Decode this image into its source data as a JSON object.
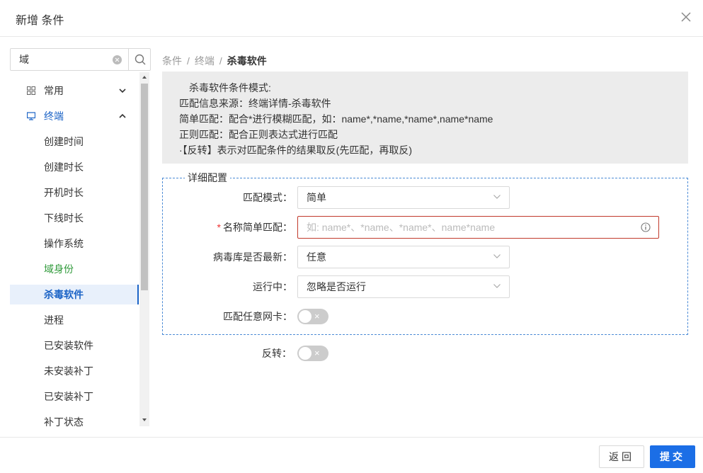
{
  "dialog": {
    "title": "新增 条件"
  },
  "search": {
    "value": "域",
    "placeholder": ""
  },
  "tree": {
    "groups": [
      {
        "label": "常用",
        "icon": "grid-icon",
        "expanded": false
      },
      {
        "label": "终端",
        "icon": "monitor-icon",
        "expanded": true
      }
    ],
    "children": [
      "创建时间",
      "创建时长",
      "开机时长",
      "下线时长",
      "操作系统",
      "域身份",
      "杀毒软件",
      "进程",
      "已安装软件",
      "未安装补丁",
      "已安装补丁",
      "补丁状态"
    ]
  },
  "breadcrumb": {
    "items": [
      "条件",
      "终端"
    ],
    "current": "杀毒软件"
  },
  "info": {
    "lines": [
      "杀毒软件条件模式:",
      "匹配信息来源：终端详情-杀毒软件",
      "简单匹配：配合*进行模糊匹配，如：name*,*name,*name*,name*name",
      "正则匹配：配合正则表达式进行匹配",
      "·【反转】表示对匹配条件的结果取反(先匹配，再取反)"
    ]
  },
  "form": {
    "legend": "详细配置",
    "match_mode": {
      "label": "匹配模式：",
      "value": "简单"
    },
    "name_match": {
      "required_mark": "*",
      "label": "名称简单匹配：",
      "placeholder": "如: name*、*name、*name*、name*name",
      "value": ""
    },
    "virus_db": {
      "label": "病毒库是否最新：",
      "value": "任意"
    },
    "running": {
      "label": "运行中：",
      "value": "忽略是否运行"
    },
    "any_nic": {
      "label": "匹配任意网卡：",
      "toggle_on": false,
      "toggle_text": "×"
    },
    "invert": {
      "label": "反转：",
      "toggle_on": false,
      "toggle_text": "×"
    }
  },
  "footer": {
    "back_label": "返回",
    "submit_label": "提交"
  },
  "colors": {
    "primary": "#1b6ee6",
    "active_text": "#1b63c6",
    "green_text": "#2f9a3a",
    "required": "#e33333"
  }
}
